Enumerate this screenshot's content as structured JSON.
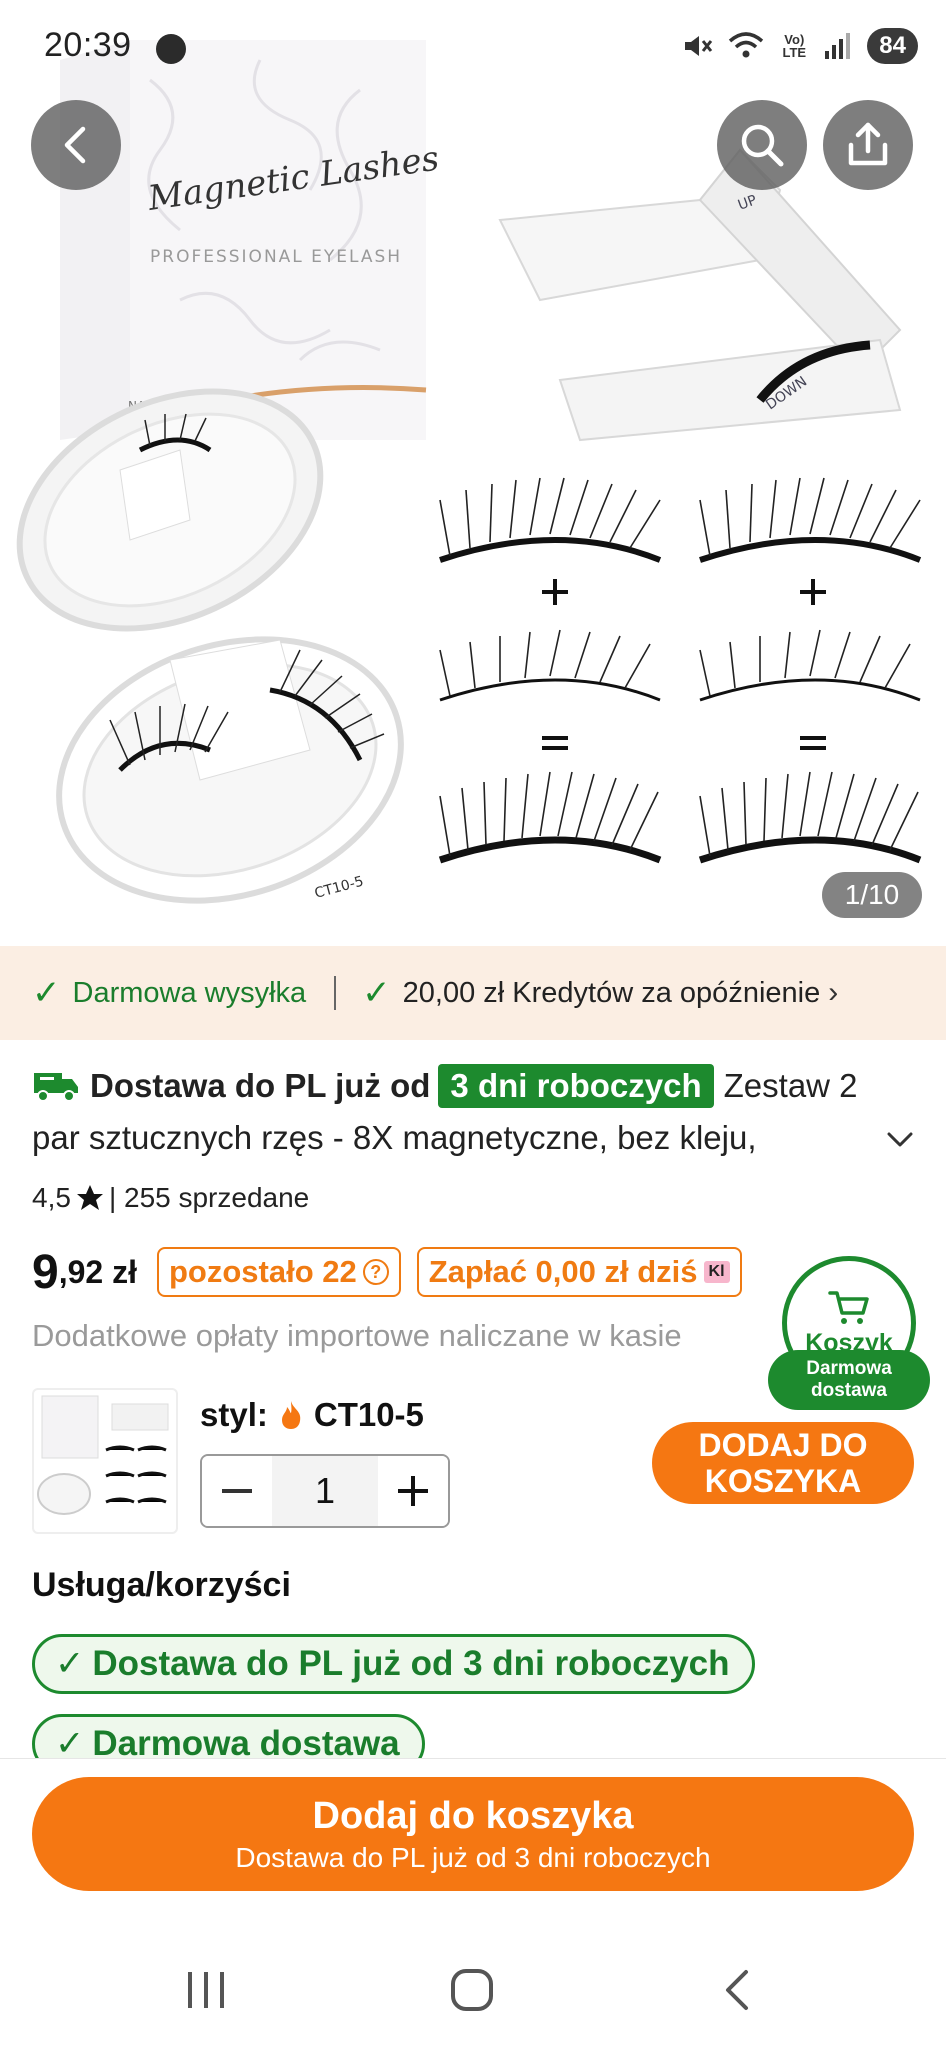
{
  "status_bar": {
    "time": "20:39",
    "network": "Vo) LTE",
    "battery": "84"
  },
  "gallery": {
    "counter": "1/10",
    "box_brand": "Magnetic Lashes",
    "box_subtitle": "PROFESSIONAL EYELASH",
    "box_side": "NATUR",
    "case_code": "CT10-5",
    "applicator_up": "UP",
    "applicator_down": "DOWN"
  },
  "benefits": {
    "free_shipping": "Darmowa wysyłka",
    "delay_credit": "20,00 zł Kredytów za opóźnienie"
  },
  "product": {
    "delivery_prefix": "Dostawa do PL już od",
    "delivery_days": "3 dni roboczych",
    "title_rest": "Zestaw 2 par sztucznych rzęs - 8X magnetyczne, bez kleju,",
    "rating": "4,5",
    "sold": "| 255 sprzedane"
  },
  "price": {
    "int": "9",
    "dec": ",92 zł",
    "remaining": "pozostało 22",
    "pay_later": "Zapłać 0,00 zł dziś",
    "klarna": "Kl"
  },
  "import_fees": "Dodatkowe opłaty importowe naliczane w kasie",
  "cart_float": {
    "label": "Koszyk",
    "free_delivery": "Darmowa dostawa"
  },
  "variant": {
    "style_label": "styl:",
    "style_value": "CT10-5",
    "quantity": "1",
    "add_button": "DODAJ DO KOSZYKA"
  },
  "services": {
    "heading": "Usługa/korzyści",
    "items": [
      "Dostawa do PL już od 3 dni roboczych",
      "Darmowa dostawa"
    ]
  },
  "bottom": {
    "button_title": "Dodaj do koszyka",
    "button_sub": "Dostawa do PL już od 3 dni roboczych"
  },
  "colors": {
    "accent_orange": "#f57712",
    "green": "#1d8a2e",
    "benefit_bg": "#fbeee3"
  }
}
